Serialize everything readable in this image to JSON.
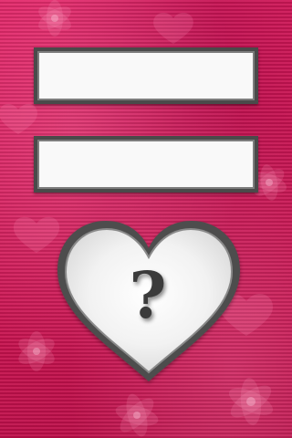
{
  "name_inputs": {
    "first_value": "",
    "second_value": ""
  },
  "calculate": {
    "icon": "question-mark-heart-icon",
    "symbol": "?"
  },
  "colors": {
    "background": "#d81b5f",
    "field_border": "#4a4a4a",
    "heart_fill": "#f4f4f4",
    "heart_outline": "#4d4d4d"
  }
}
